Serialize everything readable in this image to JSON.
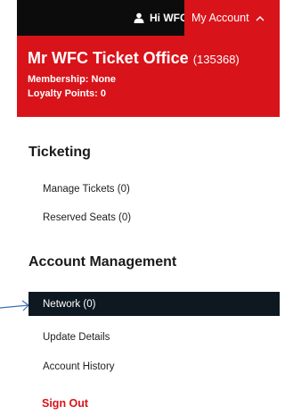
{
  "header": {
    "greeting": "Hi WFC",
    "account_label": "My Account",
    "user_icon": "user-icon",
    "chevron_icon": "chevron-up-icon"
  },
  "account": {
    "name": "Mr WFC Ticket Office",
    "id": "(135368)",
    "membership": "Membership: None",
    "loyalty_points": "Loyalty Points: 0"
  },
  "sections": {
    "ticketing": {
      "title": "Ticketing",
      "items": [
        "Manage Tickets (0)",
        "Reserved Seats (0)"
      ]
    },
    "account_management": {
      "title": "Account Management",
      "items": [
        "Network (0)",
        "Update Details",
        "Account History"
      ]
    }
  },
  "sign_out_label": "Sign Out",
  "colors": {
    "brand_red": "#d9131a",
    "dark": "#0c0c0c",
    "active_bg": "#0d1821",
    "annotation_arrow": "#3a6fb0"
  }
}
